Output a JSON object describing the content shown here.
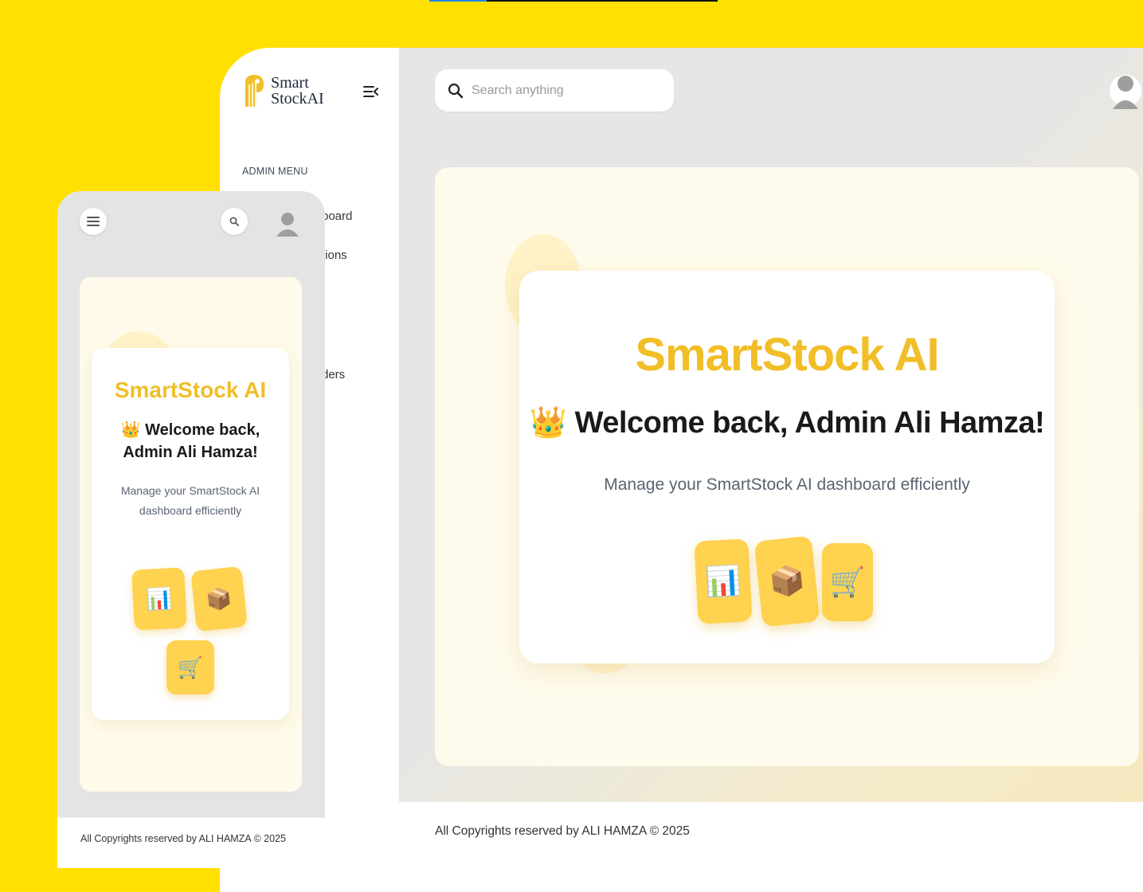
{
  "brand": {
    "name_line1": "Smart",
    "name_line2": "StockAI"
  },
  "sidebar": {
    "section_label": "ADMIN MENU",
    "items": [
      {
        "label": "board"
      },
      {
        "label": "tions"
      },
      {
        "label": "ders"
      }
    ]
  },
  "search": {
    "placeholder": "Search anything"
  },
  "hero": {
    "title": "SmartStock AI",
    "greeting_emoji": "👑",
    "greeting": "Welcome back, Admin Ali Hamza!",
    "subtitle": "Manage your SmartStock AI dashboard efficiently",
    "tiles": [
      {
        "icon": "📊",
        "name": "bar-chart-icon"
      },
      {
        "icon": "📦",
        "name": "package-icon"
      },
      {
        "icon": "🛒",
        "name": "shopping-cart-icon"
      }
    ]
  },
  "mobile_hero": {
    "title": "SmartStock AI",
    "greeting": "Welcome back, Admin Ali Hamza!",
    "subtitle": "Manage your SmartStock AI dashboard efficiently"
  },
  "footer": {
    "text": "All Copyrights reserved by ALI HAMZA © 2025"
  },
  "colors": {
    "background": "#FFE000",
    "accent": "#F2BE27",
    "tile": "#FFD24F"
  }
}
